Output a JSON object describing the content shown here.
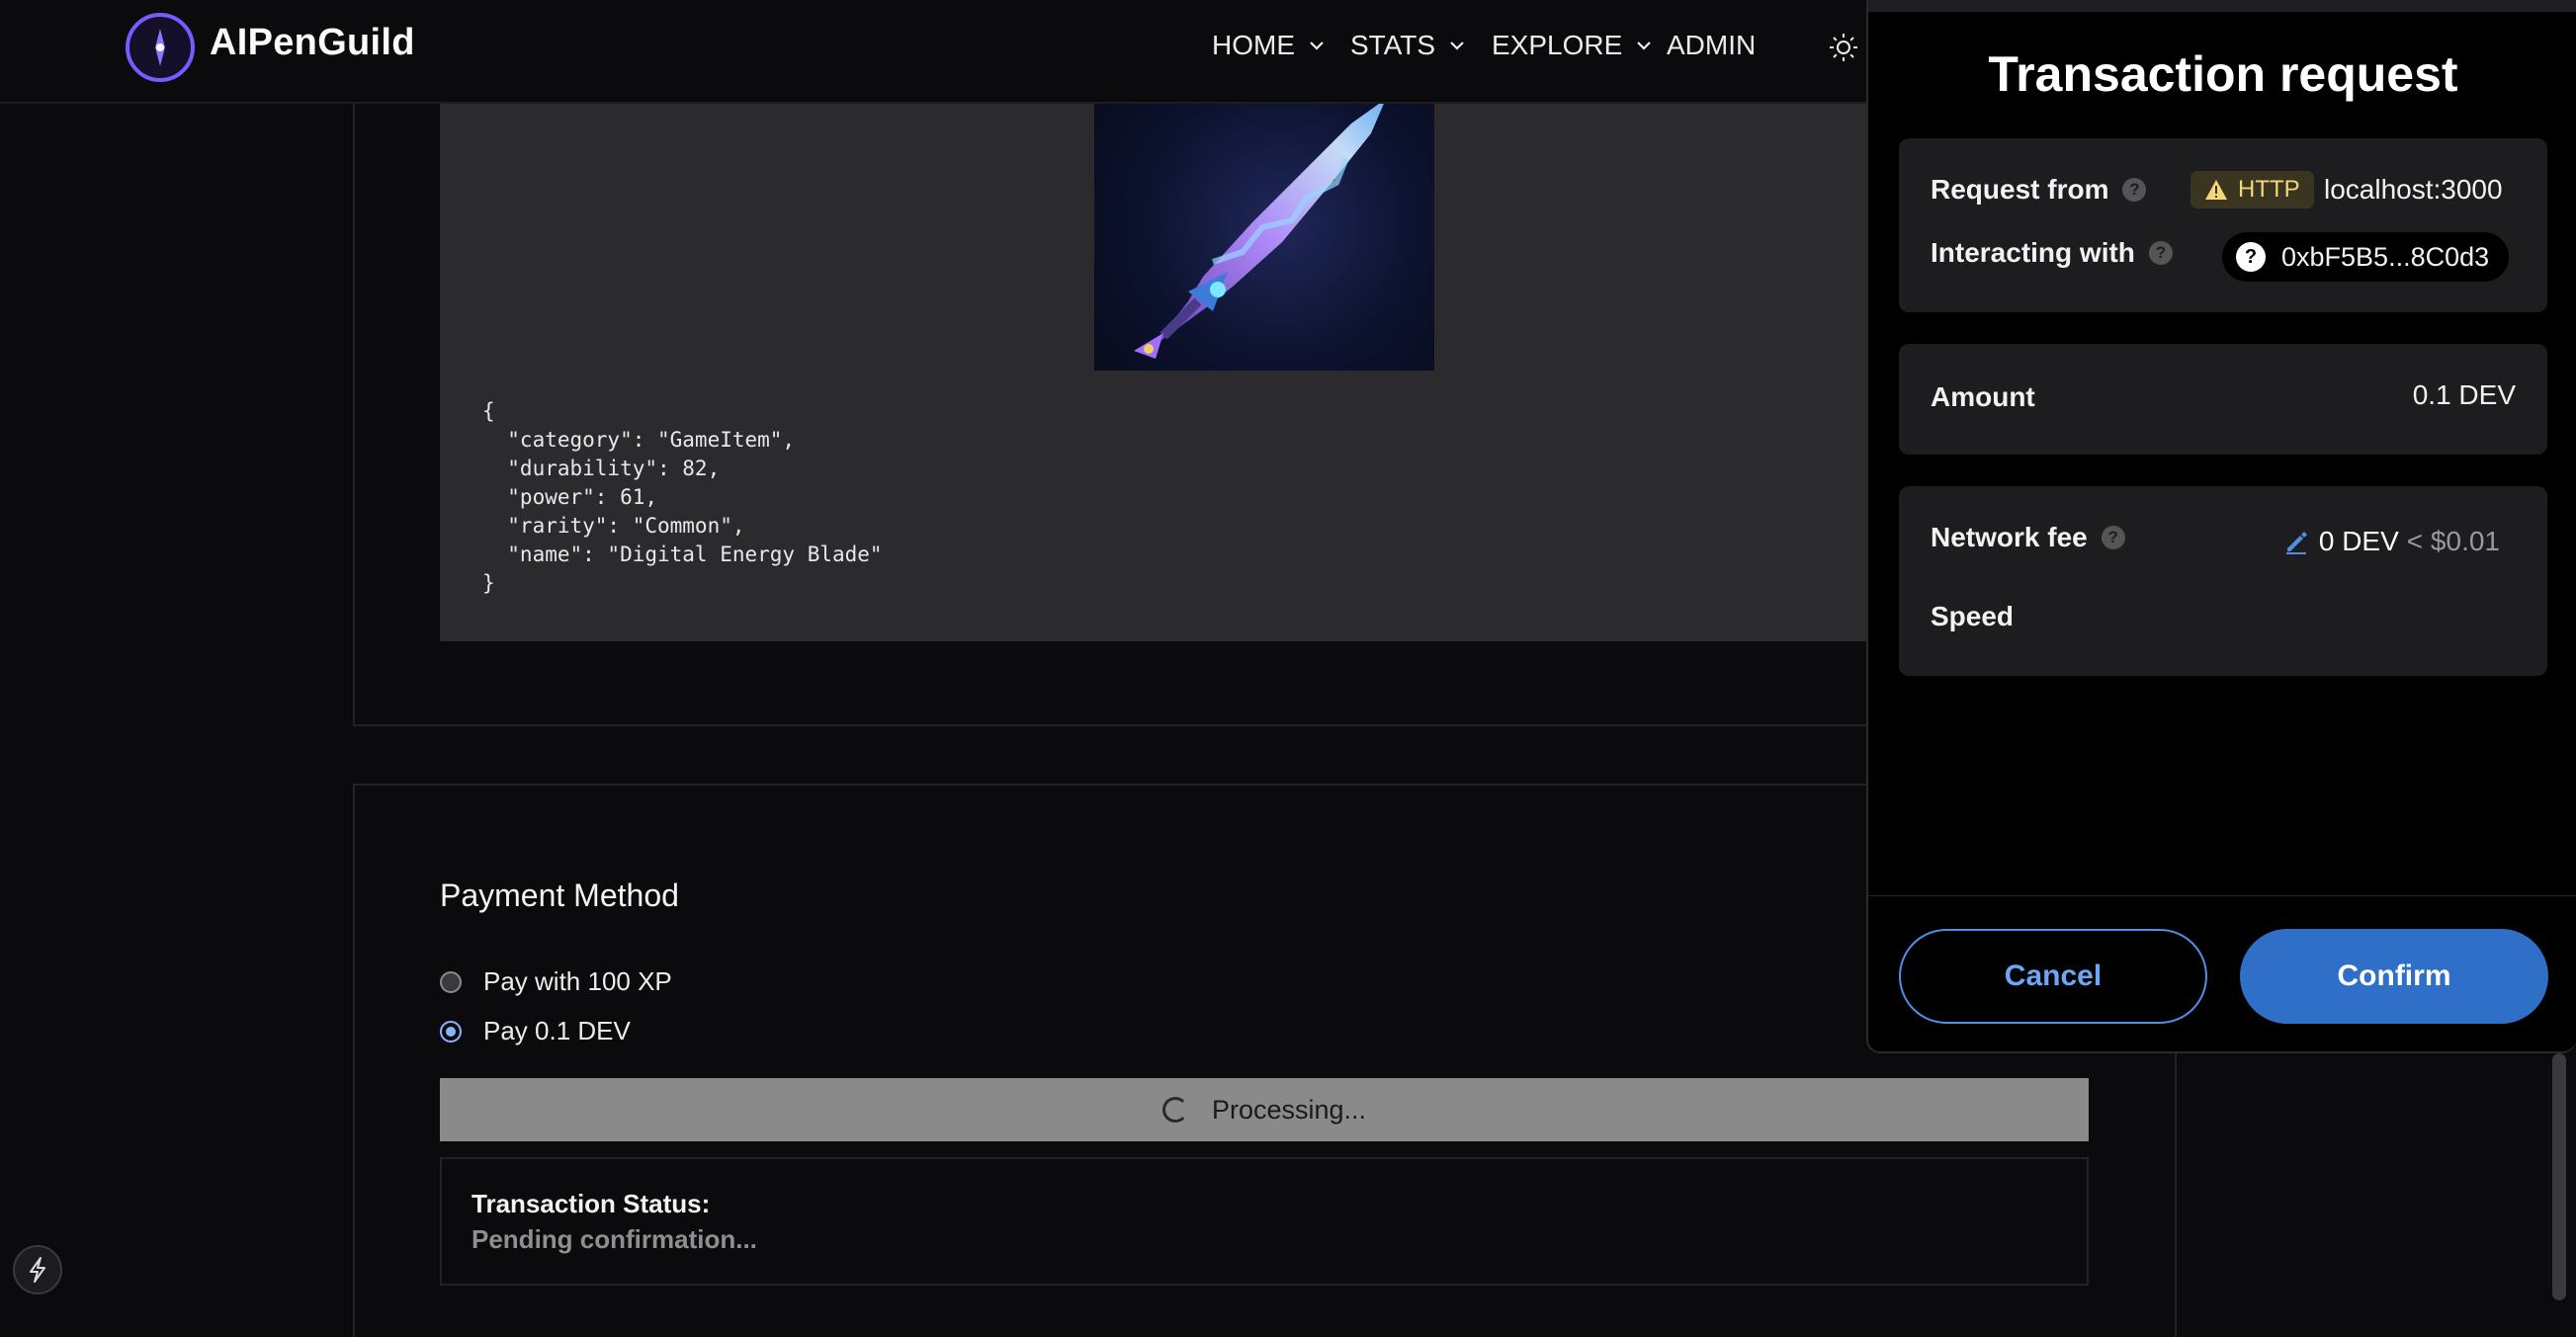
{
  "header": {
    "brand": "AIPenGuild",
    "nav": [
      {
        "label": "HOME",
        "dropdown": true
      },
      {
        "label": "STATS",
        "dropdown": true
      },
      {
        "label": "EXPLORE",
        "dropdown": true
      },
      {
        "label": "ADMIN",
        "dropdown": false
      }
    ],
    "theme_icon": "sun-icon"
  },
  "item": {
    "image_subject": "glowing energy blade",
    "metadata_lines": [
      "{",
      "  \"category\": \"GameItem\",",
      "  \"durability\": 82,",
      "  \"power\": 61,",
      "  \"rarity\": \"Common\",",
      "  \"name\": \"Digital Energy Blade\"",
      "}"
    ]
  },
  "payment": {
    "title": "Payment Method",
    "options": [
      {
        "label": "Pay with 100 XP",
        "selected": false
      },
      {
        "label": "Pay 0.1 DEV",
        "selected": true
      }
    ],
    "processing_label": "Processing...",
    "status_label": "Transaction Status:",
    "status_value": "Pending confirmation..."
  },
  "wallet": {
    "title": "Transaction request",
    "request_from_label": "Request from",
    "http_badge": "HTTP",
    "host": "localhost:3000",
    "interacting_label": "Interacting with",
    "address": "0xbF5B5...8C0d3",
    "amount_label": "Amount",
    "amount_value": "0.1 DEV",
    "fee_label": "Network fee",
    "fee_value": "0 DEV",
    "fee_usd": "< $0.01",
    "speed_label": "Speed",
    "cancel": "Cancel",
    "confirm": "Confirm"
  },
  "colors": {
    "accent": "#7a59ff",
    "wallet_primary": "#2f6fc8",
    "warning": "#f5d77a"
  }
}
